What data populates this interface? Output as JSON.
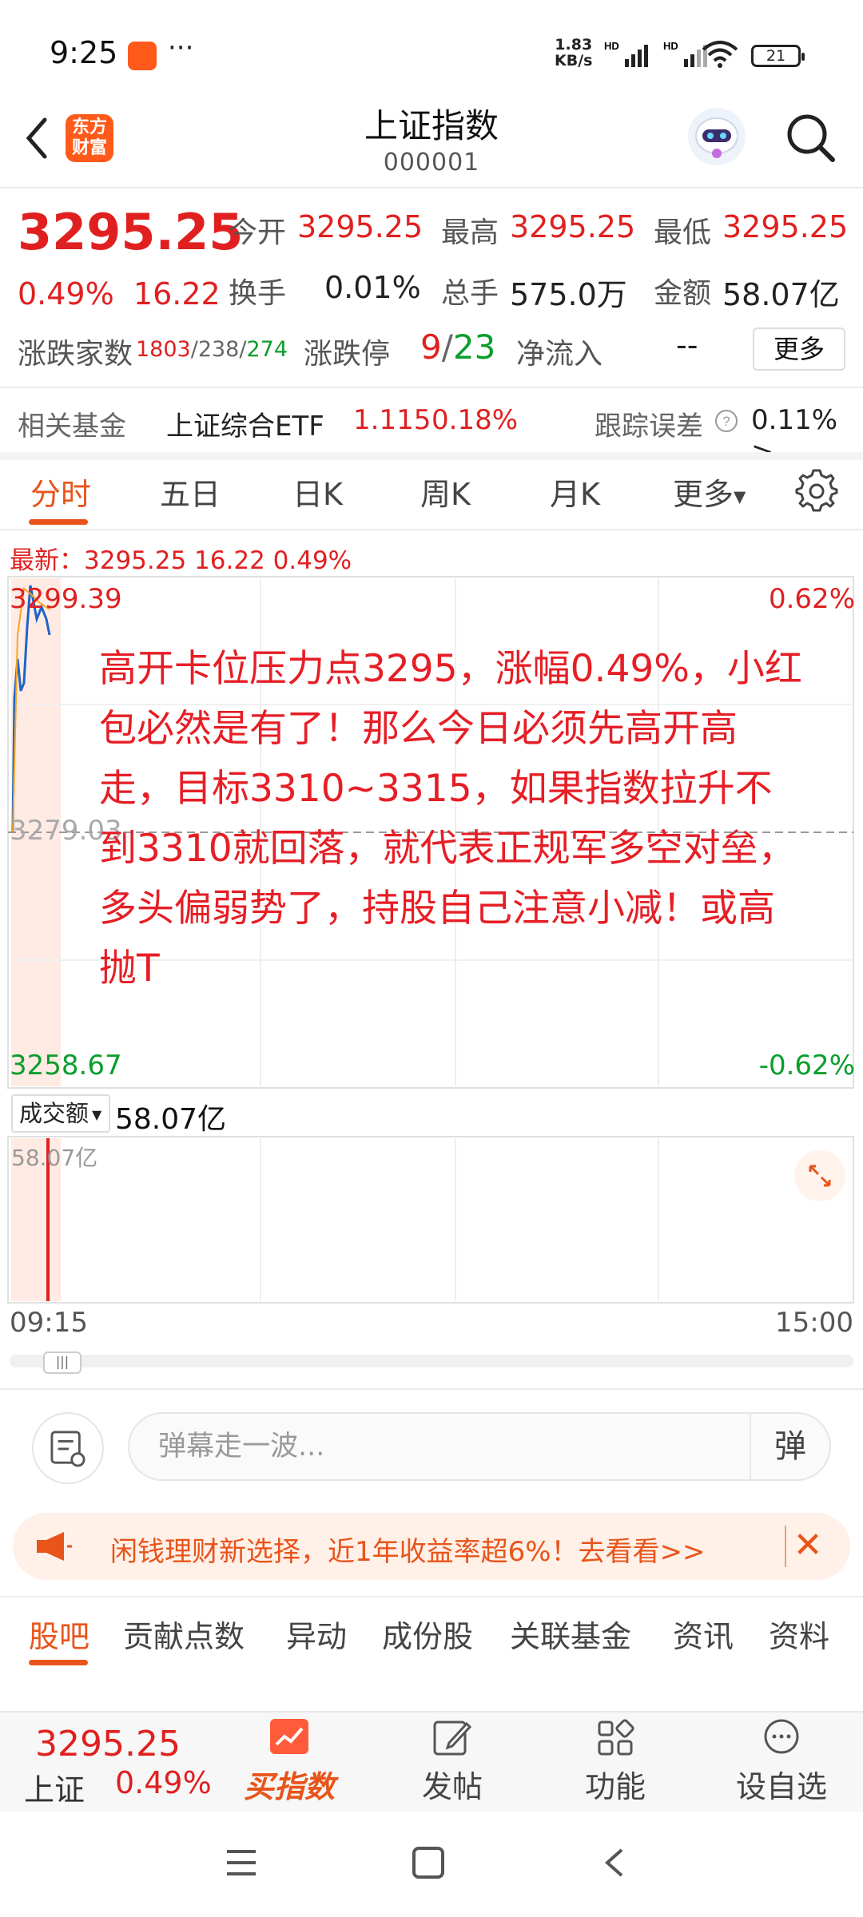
{
  "status": {
    "time": "9:25",
    "dots": "···",
    "net_speed_value": "1.83",
    "net_speed_unit": "KB/s",
    "battery": "21"
  },
  "header": {
    "brand": "东方财富",
    "title": "上证指数",
    "code": "000001"
  },
  "quote": {
    "price": "3295.25",
    "change_pct": "0.49%",
    "change": "16.22",
    "open_label": "今开",
    "open": "3295.25",
    "high_label": "最高",
    "high": "3295.25",
    "low_label": "最低",
    "low": "3295.25",
    "turnover_label": "换手",
    "turnover": "0.01%",
    "volume_label": "总手",
    "volume": "575.0万",
    "amount_label": "金额",
    "amount": "58.07亿",
    "breadth_label": "涨跌家数",
    "breadth_up": "1803",
    "breadth_flat": "238",
    "breadth_down": "274",
    "limit_label": "涨跌停",
    "limit_up": "9",
    "limit_down": "23",
    "inflow_label": "净流入",
    "inflow": "--",
    "more": "更多"
  },
  "fund": {
    "label": "相关基金",
    "name": "上证综合ETF",
    "price": "1.115",
    "pct": "0.18%",
    "tracking_label": "跟踪误差",
    "tracking": "0.11% >"
  },
  "tabs": [
    "分时",
    "五日",
    "日K",
    "周K",
    "月K",
    "更多"
  ],
  "latest": "最新：3295.25  16.22  0.49%",
  "chart_axes": {
    "top_left": "3299.39",
    "top_right": "0.62%",
    "mid_left": "3279.03",
    "bottom_left": "3258.67",
    "bottom_right": "-0.62%"
  },
  "note": "高开卡位压力点3295，涨幅0.49%，小红包必然是有了！那么今日必须先高开高走，目标3310~3315，如果指数拉升不到3310就回落，就代表正规军多空对垒，多头偏弱势了，持股自己注意小减！或高抛T",
  "volume_panel": {
    "select": "成交额",
    "value": "58.07亿",
    "axis": "58.07亿"
  },
  "time_axis": {
    "start": "09:15",
    "end": "15:00"
  },
  "danmu": {
    "placeholder": "弹幕走一波...",
    "toggle": "弹"
  },
  "promo": {
    "text": "闲钱理财新选择，近1年收益率超6%！去看看>>"
  },
  "bottom_tabs": [
    "股吧",
    "贡献点数",
    "异动",
    "成份股",
    "关联基金",
    "资讯",
    "资料"
  ],
  "bottom_bar": {
    "price": "3295.25",
    "name": "上证",
    "pct": "0.49%",
    "buy": "买指数",
    "post": "发帖",
    "functions": "功能",
    "watchlist": "设自选"
  },
  "colors": {
    "up": "#e02020",
    "down": "#0a9e2c",
    "accent": "#e8541a"
  }
}
